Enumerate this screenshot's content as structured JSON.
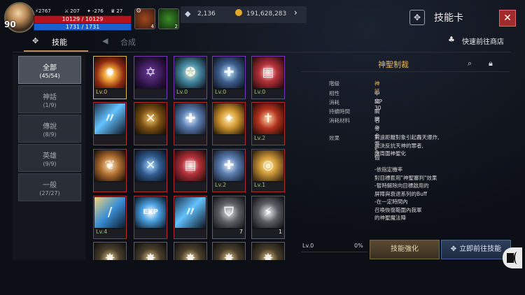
{
  "player": {
    "level": "90",
    "stat1": "⚡2767",
    "stat2": "207",
    "stat3": "-276",
    "stat4": "27",
    "hp": "10129 / 10129",
    "mp": "1731 / 1731",
    "slot1_count": "4",
    "slot2_count": "2"
  },
  "currency": {
    "diamond": "2,136",
    "gold": "191,628,283"
  },
  "window": {
    "title": "技能卡",
    "close_label": "✕"
  },
  "tabs": [
    {
      "label": "技能",
      "active": true
    },
    {
      "label": "合成",
      "active": false
    }
  ],
  "shop_link": "快速前往商店",
  "categories": [
    {
      "name": "全部",
      "count": "(45/54)",
      "active": true
    },
    {
      "name": "神話",
      "count": "(1/9)"
    },
    {
      "name": "傳說",
      "count": "(8/9)"
    },
    {
      "name": "英雄",
      "count": "(9/9)"
    },
    {
      "name": "一般",
      "count": "(27/27)"
    }
  ],
  "cards": [
    {
      "border": "gold",
      "lv": "Lv.0",
      "art": "burst"
    },
    {
      "border": "purple",
      "lv": "",
      "art": "hexstar"
    },
    {
      "border": "purple",
      "lv": "Lv.0",
      "art": "star"
    },
    {
      "border": "purple",
      "lv": "Lv.0",
      "art": "shieldcross"
    },
    {
      "border": "purple",
      "lv": "Lv.0",
      "art": "redbook"
    },
    {
      "border": "red",
      "lv": "",
      "art": "feather"
    },
    {
      "border": "red",
      "lv": "",
      "art": "xshield"
    },
    {
      "border": "red",
      "lv": "",
      "art": "bluebook"
    },
    {
      "border": "red",
      "lv": "",
      "art": "wings"
    },
    {
      "border": "red",
      "lv": "Lv.2",
      "art": "cross"
    },
    {
      "border": "red",
      "lv": "",
      "art": "hands"
    },
    {
      "border": "red",
      "lv": "",
      "art": "blueshield"
    },
    {
      "border": "red",
      "lv": "",
      "art": "redbook"
    },
    {
      "border": "red",
      "lv": "Lv.2",
      "art": "bluebook"
    },
    {
      "border": "red",
      "lv": "Lv.1",
      "art": "swirl"
    },
    {
      "border": "red",
      "lv": "Lv.4",
      "art": "sword"
    },
    {
      "border": "red",
      "lv": "",
      "art": "exp"
    },
    {
      "border": "red",
      "lv": "",
      "art": "feather"
    },
    {
      "border": "gray",
      "lv": "",
      "qty": "7",
      "art": "grayshield"
    },
    {
      "border": "gray",
      "lv": "",
      "qty": "1",
      "art": "bolt"
    },
    {
      "border": "gray",
      "lv": "",
      "art": "partial"
    },
    {
      "border": "gray",
      "lv": "",
      "art": "partial"
    },
    {
      "border": "gray",
      "lv": "",
      "art": "partial"
    },
    {
      "border": "gray",
      "lv": "",
      "art": "partial"
    },
    {
      "border": "gray",
      "lv": "",
      "art": "partial"
    }
  ],
  "detail": {
    "title": "神聖制裁",
    "rows": [
      {
        "k": "階級",
        "v": "神話",
        "gold": true
      },
      {
        "k": "相性",
        "v": "中立"
      },
      {
        "k": "消耗",
        "v": "MP 30"
      },
      {
        "k": "持續時間",
        "v": "瞬間"
      },
      {
        "k": "消耗材料",
        "v": "名譽金幣 5個"
      }
    ],
    "effect_label": "效果",
    "effect_text": "對遠距離對象引起轟天爆炸,\n處決反抗天神的罪者,\n讓周圍神聖化\n\n-依指定機率\n對目標套用\"神聖審判\"效果\n-暫時解除向目標啟用的\n屏障與衰退系列的Buff\n-在一定時間內\n召喚恢復範圍內我軍\n的神聖魔法陣",
    "progress_lv": "Lv.0",
    "progress_pct": "0%",
    "enhance_label": "技能強化",
    "goto_label": "立即前往技能"
  },
  "colors": {
    "gold_accent": "#e3b55f",
    "hp": "#b3131c",
    "mp": "#1a5fd1",
    "close": "#a12a2a"
  }
}
